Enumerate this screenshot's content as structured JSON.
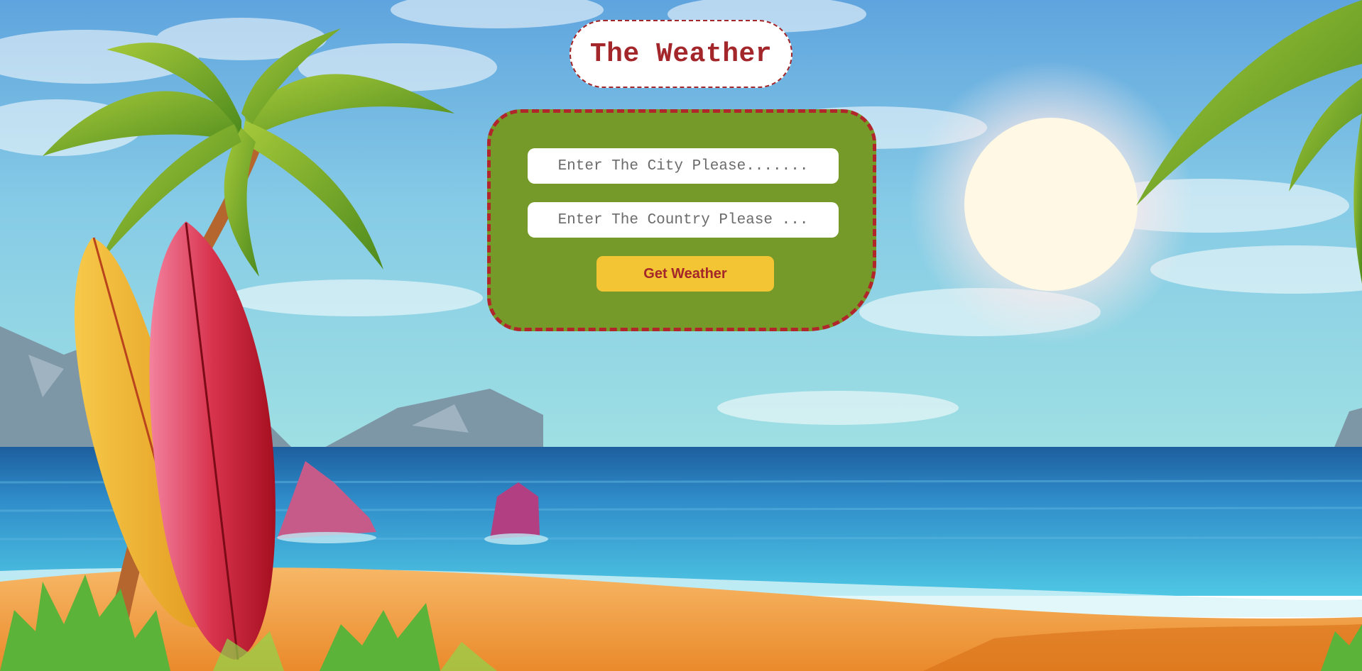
{
  "header": {
    "title": "The Weather"
  },
  "form": {
    "city_placeholder": "Enter The City Please.......",
    "country_placeholder": "Enter The Country Please ...",
    "submit_label": "Get Weather"
  },
  "colors": {
    "title_text": "#a3262a",
    "card_background": "#769a29",
    "card_border": "#b0262b",
    "button_background": "#f3c433",
    "button_text": "#a3262a"
  },
  "background": {
    "scene": "beach-illustration",
    "elements": [
      "sky",
      "clouds",
      "sun",
      "mountains",
      "sea",
      "rocks",
      "sand",
      "palm-trees",
      "surfboards",
      "bushes"
    ]
  }
}
